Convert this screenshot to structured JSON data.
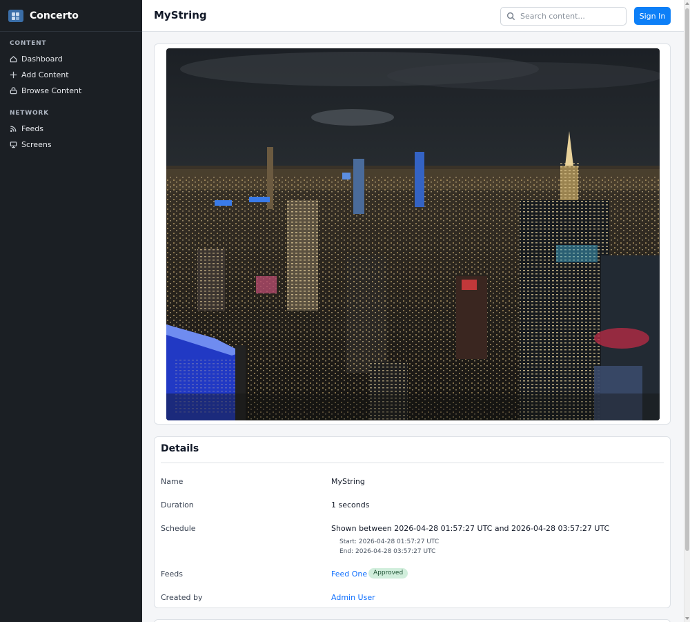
{
  "app": {
    "name": "Concerto"
  },
  "sidebar": {
    "sections": [
      {
        "heading": "CONTENT",
        "items": [
          {
            "label": "Dashboard",
            "icon": "home-icon"
          },
          {
            "label": "Add Content",
            "icon": "plus-icon"
          },
          {
            "label": "Browse Content",
            "icon": "lock-icon"
          }
        ]
      },
      {
        "heading": "NETWORK",
        "items": [
          {
            "label": "Feeds",
            "icon": "rss-icon"
          },
          {
            "label": "Screens",
            "icon": "monitor-icon"
          }
        ]
      }
    ]
  },
  "header": {
    "title": "MyString",
    "search_placeholder": "Search content...",
    "signin_label": "Sign In"
  },
  "media": {
    "image_description": "night skyline photo"
  },
  "details": {
    "title": "Details",
    "name_label": "Name",
    "name_value": "MyString",
    "duration_label": "Duration",
    "duration_value": "1 seconds",
    "schedule_label": "Schedule",
    "schedule_value": "Shown between 2026-04-28 01:57:27 UTC and 2026-04-28 03:57:27 UTC",
    "schedule_start": "Start: 2026-04-28 01:57:27 UTC",
    "schedule_end": "End: 2026-04-28 03:57:27 UTC",
    "feeds_label": "Feeds",
    "feed_name": "Feed One",
    "feed_status": "Approved",
    "created_label": "Created by",
    "created_value": "Admin User"
  },
  "colors": {
    "sidebar_bg": "#1b1f24",
    "primary": "#0d7ff7",
    "link": "#0d6efd",
    "badge_bg": "#d1eedc"
  }
}
